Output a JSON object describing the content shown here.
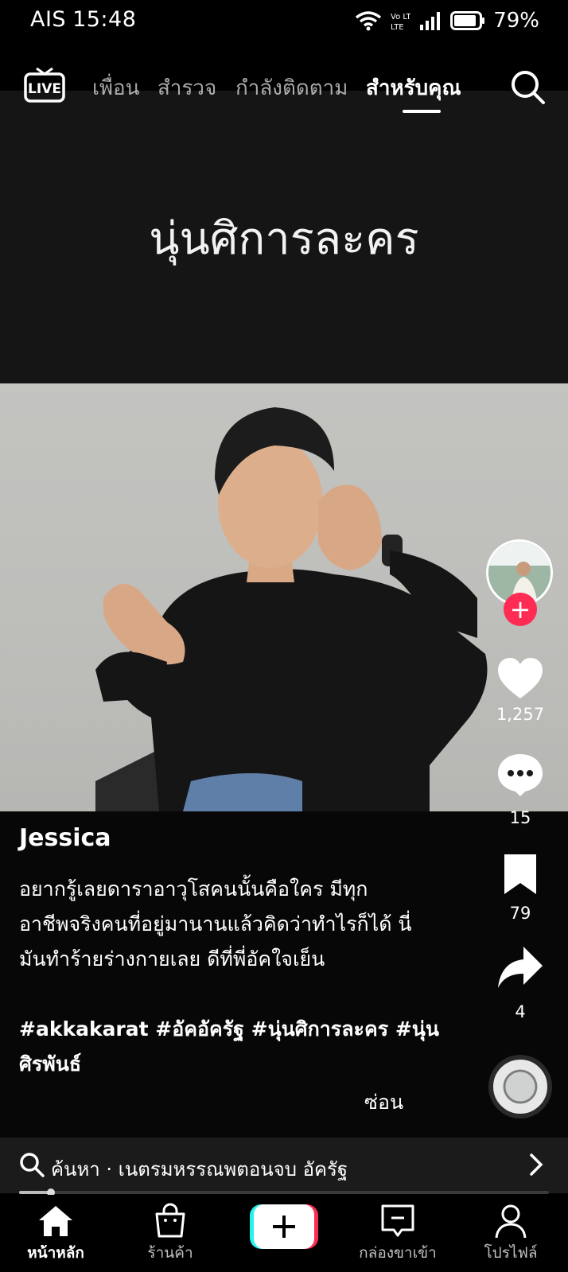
{
  "status_bar": {
    "carrier": "AIS",
    "time": "15:48",
    "network": "Vo LTE",
    "battery": "79%"
  },
  "top_nav": {
    "live_label": "LIVE",
    "tabs": [
      "เพื่อน",
      "สำรวจ",
      "กำลังติดตาม",
      "สำหรับคุณ"
    ],
    "active_tab": "สำหรับคุณ"
  },
  "video": {
    "overlay_title": "นุ่นศิการละคร"
  },
  "rail": {
    "likes": "1,257",
    "comments": "15",
    "saves": "79",
    "shares": "4"
  },
  "caption": {
    "username": "Jessica",
    "text": "อยากรู้เลยดาราอาวุโสคนนั้นคือใคร มีทุกอาชีพจริงคนที่อยู่มานานแล้วคิดว่าทำไรก็ได้ นี่มันทำร้ายร่างกายเลย ดีที่พี่อัคใจเย็น",
    "hashtags": "#akkakarat #อัคอัครัฐ #นุ่นศิการละคร #นุ่นศิรพันธ์",
    "hide_label": "ซ่อน"
  },
  "search_suggestion": {
    "text": "ค้นหา · เนตรมหรรณพตอนจบ อัครัฐ"
  },
  "progress": {
    "value": 0.06
  },
  "bottom_nav": {
    "home": "หน้าหลัก",
    "shop": "ร้านค้า",
    "inbox": "กล่องขาเข้า",
    "profile": "โปรไฟล์"
  },
  "colors": {
    "accent_red": "#fe2c55",
    "accent_cyan": "#25f4ee"
  }
}
